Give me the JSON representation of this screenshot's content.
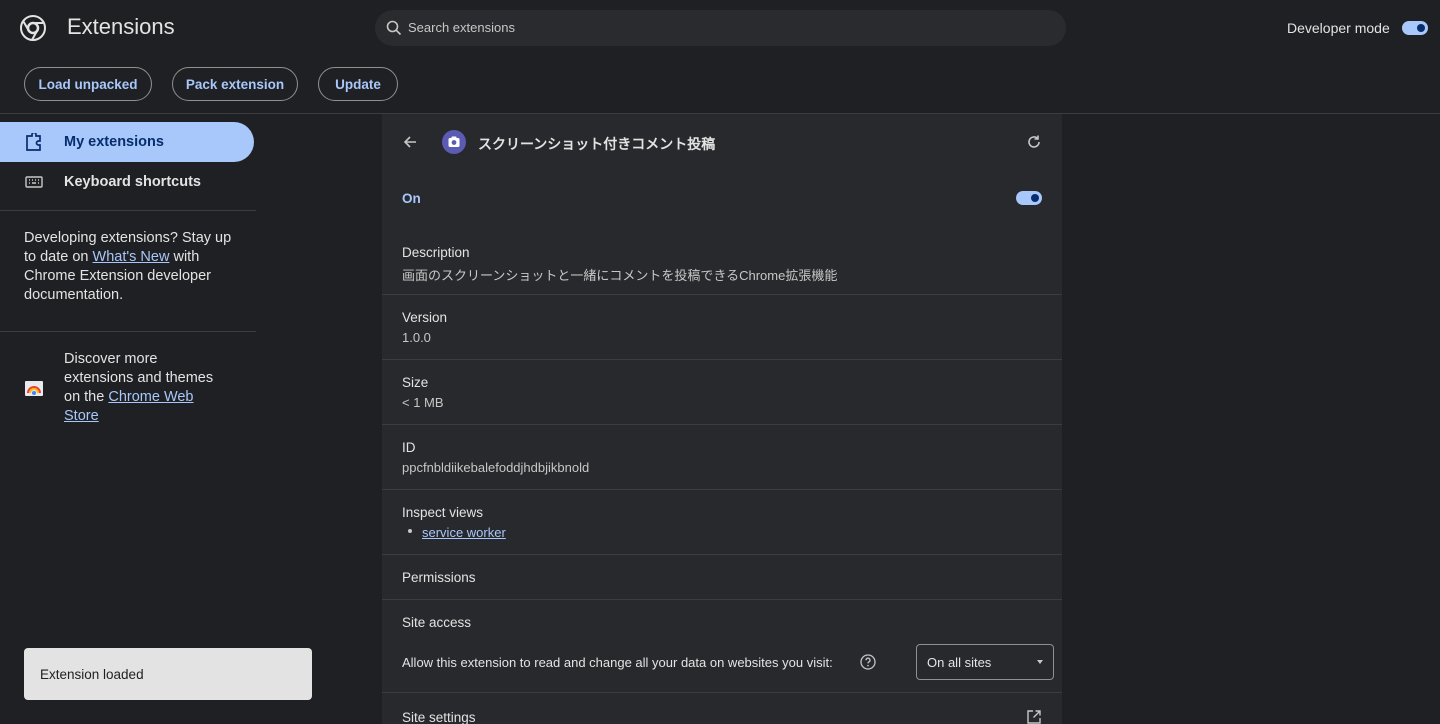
{
  "header": {
    "title": "Extensions",
    "search_placeholder": "Search extensions",
    "developer_mode_label": "Developer mode",
    "developer_mode_on": true
  },
  "actions": {
    "load_unpacked": "Load unpacked",
    "pack_extension": "Pack extension",
    "update": "Update"
  },
  "sidebar": {
    "items": [
      {
        "label": "My extensions",
        "icon": "puzzle-icon",
        "active": true
      },
      {
        "label": "Keyboard shortcuts",
        "icon": "keyboard-icon",
        "active": false
      }
    ],
    "dev_text_before": "Developing extensions? Stay up to date on ",
    "dev_link": "What's New",
    "dev_text_after": " with Chrome Extension developer documentation.",
    "store_text_before": "Discover more extensions and themes on the ",
    "store_link": "Chrome Web Store"
  },
  "toast": {
    "text": "Extension loaded"
  },
  "detail": {
    "name": "スクリーンショット付きコメント投稿",
    "status_label": "On",
    "enabled": true,
    "description_label": "Description",
    "description": "画面のスクリーンショットと一緒にコメントを投稿できるChrome拡張機能",
    "version_label": "Version",
    "version": "1.0.0",
    "size_label": "Size",
    "size": "< 1 MB",
    "id_label": "ID",
    "id": "ppcfnbldiikebalefoddjhdbjikbnold",
    "inspect_label": "Inspect views",
    "inspect_views": [
      "service worker"
    ],
    "permissions_label": "Permissions",
    "site_access_label": "Site access",
    "site_access_text": "Allow this extension to read and change all your data on websites you visit:",
    "site_access_value": "On all sites",
    "site_settings_label": "Site settings"
  },
  "colors": {
    "background": "#1f2023",
    "panel": "#28292c",
    "accent": "#a8c7fa",
    "text": "#e3e3e3"
  }
}
